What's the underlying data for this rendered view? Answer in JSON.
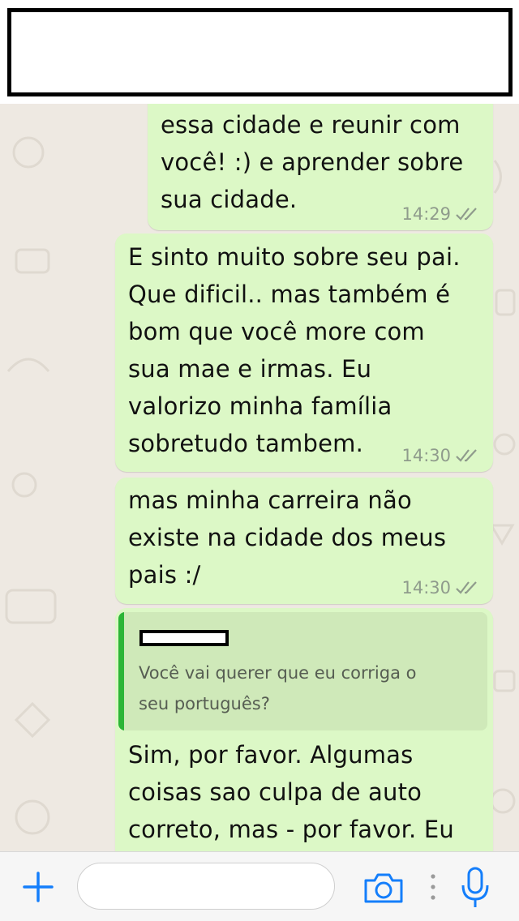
{
  "messages": [
    {
      "text": "essa cidade e reunir com\nvocê! :) e aprender sobre\nsua cidade.",
      "time": "14:29",
      "status": "read"
    },
    {
      "text": "E sinto muito sobre seu pai.\nQue dificil.. mas também é\nbom que você more com\nsua mae e irmas.  Eu\nvalorizo minha família\nsobretudo tambem.",
      "time": "14:30",
      "status": "read"
    },
    {
      "text": "mas minha carreira não\nexiste na cidade dos meus\npais :/",
      "time": "14:30",
      "status": "read"
    },
    {
      "quoted": {
        "text": "Você vai querer que eu corriga o\nseu português?"
      },
      "text": "Sim, por favor.  Algumas\ncoisas sao culpa de auto\ncorreto, mas - por favor. Eu"
    }
  ],
  "input_bar": {
    "placeholder": ""
  },
  "icons": {
    "attach": "plus-icon",
    "camera": "camera-icon",
    "more": "dots-icon",
    "mic": "microphone-icon",
    "read": "double-check-icon"
  },
  "colors": {
    "outgoing_bubble": "#dcf8c6",
    "quote_bar": "#2cb537",
    "accent_blue": "#147efb",
    "tick_gray": "#8f9b8c"
  }
}
